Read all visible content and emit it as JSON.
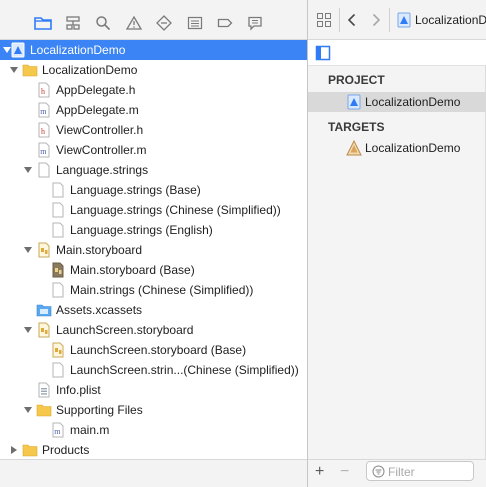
{
  "navigator": {
    "tabs": [
      {
        "icon": "folder-icon",
        "active": true
      },
      {
        "icon": "hierarchy-icon",
        "active": false
      },
      {
        "icon": "search-icon",
        "active": false
      },
      {
        "icon": "warning-icon",
        "active": false
      },
      {
        "icon": "diamond-icon",
        "active": false
      },
      {
        "icon": "list-icon",
        "active": false
      },
      {
        "icon": "tag-icon",
        "active": false
      },
      {
        "icon": "message-icon",
        "active": false
      }
    ],
    "tree": [
      {
        "label": "LocalizationDemo",
        "icon": "project-icon",
        "expanded": true,
        "selected": true
      },
      {
        "label": "LocalizationDemo",
        "icon": "group-folder-icon",
        "expanded": true
      },
      {
        "label": "AppDelegate.h",
        "icon": "header-file-icon"
      },
      {
        "label": "AppDelegate.m",
        "icon": "source-file-icon"
      },
      {
        "label": "ViewController.h",
        "icon": "header-file-icon"
      },
      {
        "label": "ViewController.m",
        "icon": "source-file-icon"
      },
      {
        "label": "Language.strings",
        "icon": "document-icon",
        "expanded": true
      },
      {
        "label": "Language.strings (Base)",
        "icon": "document-icon"
      },
      {
        "label": "Language.strings (Chinese (Simplified))",
        "icon": "document-icon"
      },
      {
        "label": "Language.strings (English)",
        "icon": "document-icon"
      },
      {
        "label": "Main.storyboard",
        "icon": "storyboard-icon",
        "expanded": true
      },
      {
        "label": "Main.storyboard (Base)",
        "icon": "storyboard-base-icon"
      },
      {
        "label": "Main.strings (Chinese (Simplified))",
        "icon": "document-icon"
      },
      {
        "label": "Assets.xcassets",
        "icon": "asset-catalog-icon"
      },
      {
        "label": "LaunchScreen.storyboard",
        "icon": "storyboard-icon",
        "expanded": true
      },
      {
        "label": "LaunchScreen.storyboard (Base)",
        "icon": "storyboard-icon"
      },
      {
        "label": "LaunchScreen.strin...(Chinese (Simplified))",
        "icon": "document-icon"
      },
      {
        "label": "Info.plist",
        "icon": "plist-icon"
      },
      {
        "label": "Supporting Files",
        "icon": "group-folder-icon",
        "expanded": true
      },
      {
        "label": "main.m",
        "icon": "source-file-icon"
      },
      {
        "label": "Products",
        "icon": "group-folder-icon",
        "expanded": false
      }
    ]
  },
  "jump_bar": {
    "crumb": "LocalizationDe"
  },
  "project_editor": {
    "project_heading": "PROJECT",
    "project_item": "LocalizationDemo",
    "targets_heading": "TARGETS",
    "target_item": "LocalizationDemo",
    "add_label": "+",
    "remove_label": "−",
    "filter_placeholder": "Filter"
  },
  "colors": {
    "selection": "#3b84f5",
    "folder": "#f5c74a",
    "toolbar_bg": "#f3f3f3"
  }
}
